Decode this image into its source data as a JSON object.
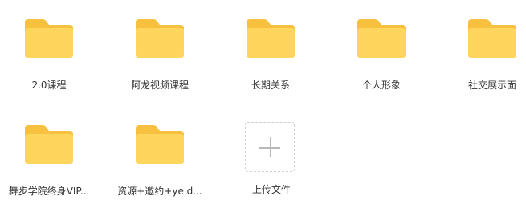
{
  "folders": [
    {
      "name": "2.0课程"
    },
    {
      "name": "阿龙视频课程"
    },
    {
      "name": "长期关系"
    },
    {
      "name": "个人形象"
    },
    {
      "name": "社交展示面"
    },
    {
      "name": "舞步学院终身VIP..."
    },
    {
      "name": "资源+邀约+ye d..."
    }
  ],
  "upload": {
    "label": "上传文件",
    "icon": "plus-icon"
  },
  "colors": {
    "folder_body": "#FFD55E",
    "folder_back": "#F7C13F",
    "text": "#333333",
    "upload_border": "#CFCFCF",
    "upload_plus": "#B8B8B8"
  }
}
